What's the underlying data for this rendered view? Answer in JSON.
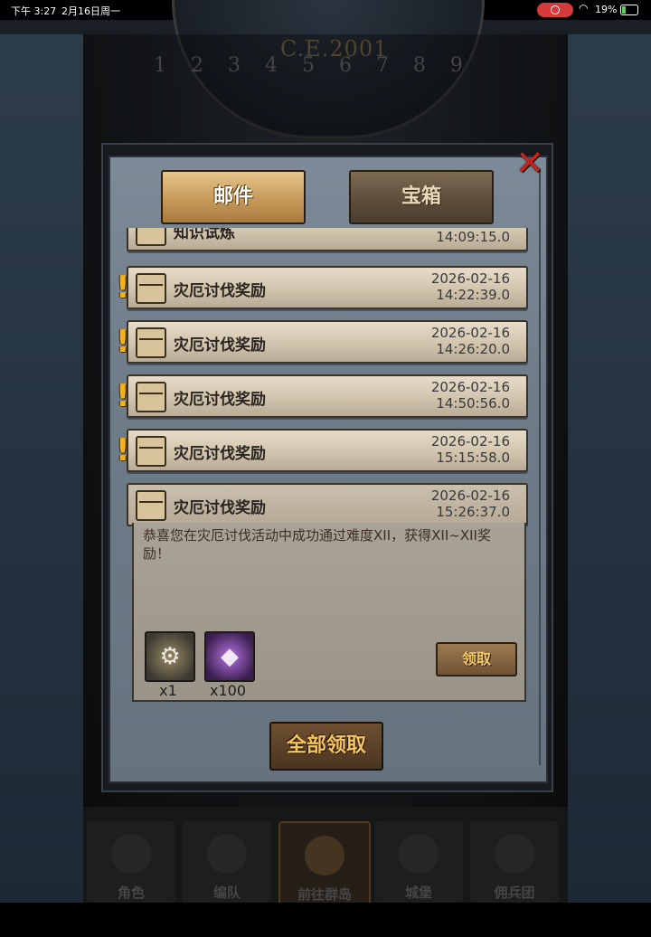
{
  "status_bar": {
    "time": "下午 3:27",
    "date": "2月16日周一",
    "battery": "19%",
    "wifi_icon": "wifi-icon",
    "record_icon": "screen-record-icon"
  },
  "background": {
    "year": "C.E.2001",
    "dial_numbers": "1 2 3 4 5 6 7 8 9"
  },
  "tabs": {
    "mail": "邮件",
    "chest": "宝箱"
  },
  "mails": [
    {
      "title": "知识试炼",
      "date": "",
      "time": "14:09:15.0",
      "alert": false
    },
    {
      "title": "灾厄讨伐奖励",
      "date": "2026-02-16",
      "time": "14:22:39.0",
      "alert": true
    },
    {
      "title": "灾厄讨伐奖励",
      "date": "2026-02-16",
      "time": "14:26:20.0",
      "alert": true
    },
    {
      "title": "灾厄讨伐奖励",
      "date": "2026-02-16",
      "time": "14:50:56.0",
      "alert": true
    },
    {
      "title": "灾厄讨伐奖励",
      "date": "2026-02-16",
      "time": "15:15:58.0",
      "alert": true
    },
    {
      "title": "灾厄讨伐奖励",
      "date": "2026-02-16",
      "time": "15:26:37.0",
      "alert": false
    }
  ],
  "alert_mark": "!",
  "detail": {
    "message": "恭喜您在灾厄讨伐活动中成功通过难度XII，获得XII~XII奖励！",
    "items": [
      {
        "icon": "gear-emblem-icon",
        "count": "x1"
      },
      {
        "icon": "purple-crystal-icon",
        "count": "x100"
      }
    ],
    "claim_label": "领取"
  },
  "claim_all_label": "全部领取",
  "close_icon": "✕",
  "nav": [
    {
      "label": "角色",
      "icon": "knight-icon"
    },
    {
      "label": "编队",
      "icon": "helmet-icon"
    },
    {
      "label": "前往群岛",
      "icon": "compass-icon"
    },
    {
      "label": "城堡",
      "icon": "castle-icon"
    },
    {
      "label": "佣兵团",
      "icon": "banner-icon"
    }
  ],
  "colors": {
    "tab_active": "#c79a5a",
    "claim_text": "#f3c563",
    "alert": "#f3b21a",
    "close": "#c8221c"
  }
}
